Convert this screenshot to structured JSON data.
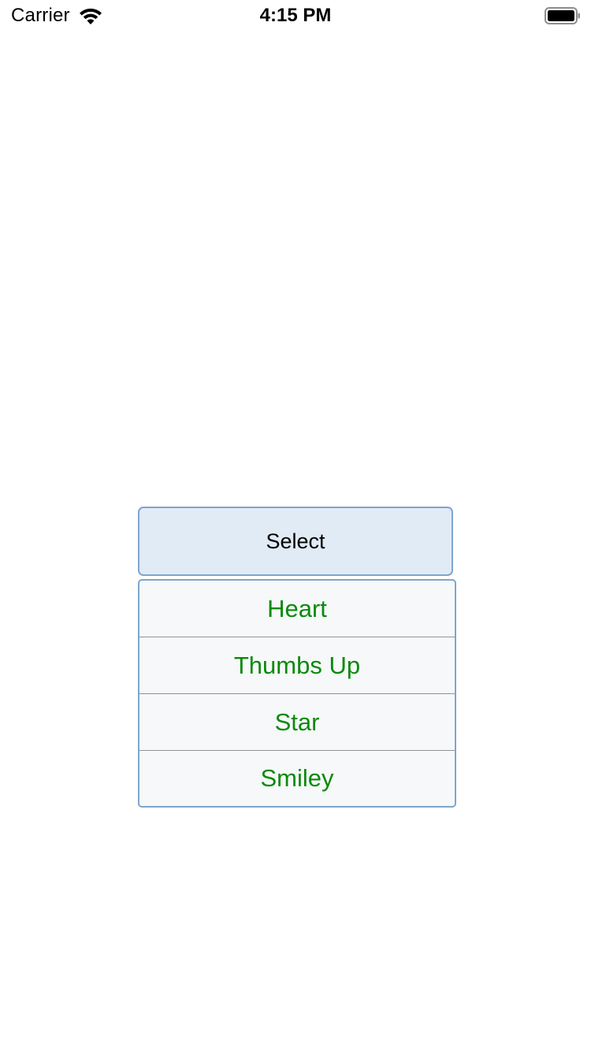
{
  "status_bar": {
    "carrier": "Carrier",
    "time": "4:15 PM",
    "wifi_icon": "wifi-icon",
    "battery_icon": "battery-icon"
  },
  "dropdown": {
    "button_label": "Select",
    "item_color": "#0a8a0a",
    "items": [
      {
        "label": "Heart"
      },
      {
        "label": "Thumbs Up"
      },
      {
        "label": "Star"
      },
      {
        "label": "Smiley"
      }
    ]
  }
}
